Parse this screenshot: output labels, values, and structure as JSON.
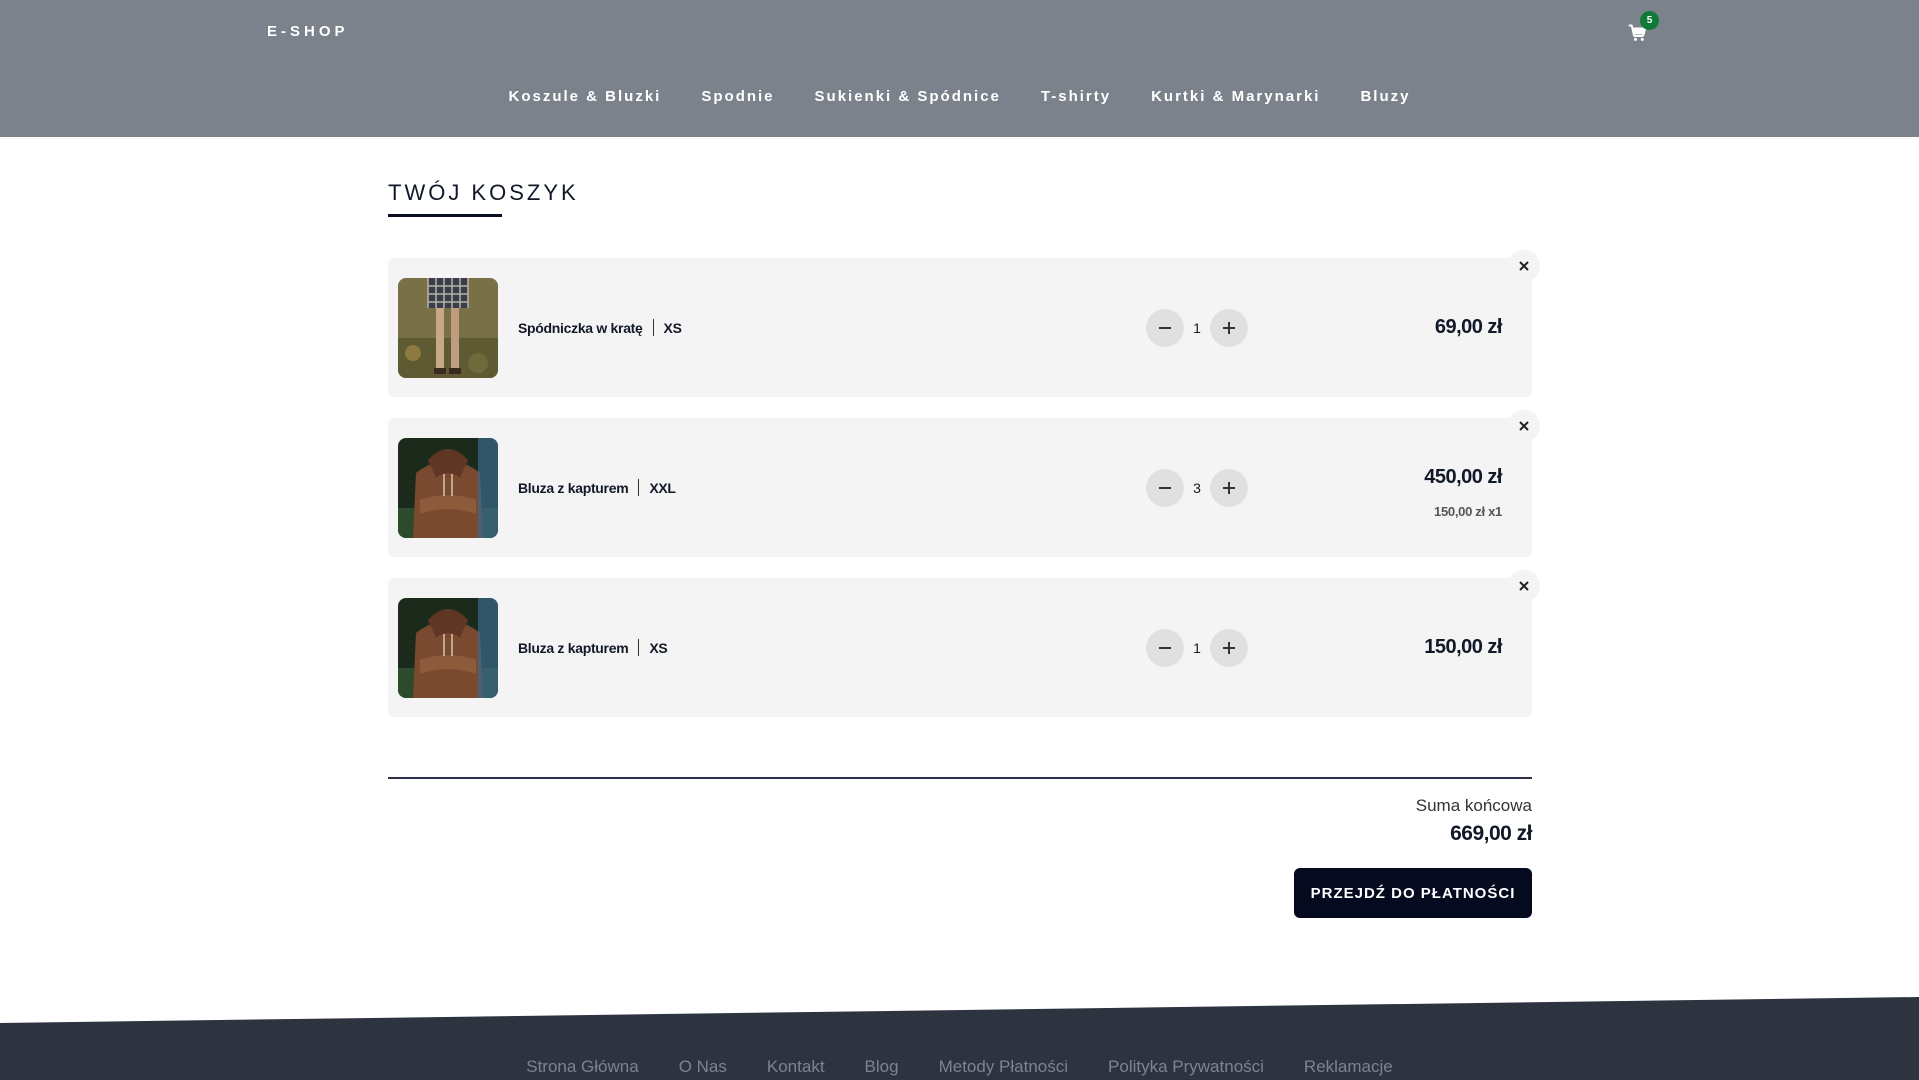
{
  "header": {
    "logo": "E-SHOP",
    "cart_count": "5",
    "nav": [
      "Koszule & Bluzki",
      "Spodnie",
      "Sukienki & Spódnice",
      "T-shirty",
      "Kurtki & Marynarki",
      "Bluzy"
    ]
  },
  "cart": {
    "title": "TWÓJ KOSZYK",
    "items": [
      {
        "name": "Spódniczka w kratę",
        "size": "XS",
        "qty": "1",
        "price": "69,00 zł",
        "unit_price": ""
      },
      {
        "name": "Bluza z kapturem",
        "size": "XXL",
        "qty": "3",
        "price": "450,00 zł",
        "unit_price": "150,00 zł x1"
      },
      {
        "name": "Bluza z kapturem",
        "size": "XS",
        "qty": "1",
        "price": "150,00 zł",
        "unit_price": ""
      }
    ],
    "total_label": "Suma końcowa",
    "total_value": "669,00 zł",
    "checkout_label": "PRZEJDŹ DO PŁATNOŚCI"
  },
  "footer": {
    "links": [
      "Strona Główna",
      "O Nas",
      "Kontakt",
      "Blog",
      "Metody Płatności",
      "Polityka Prywatności",
      "Reklamacje"
    ]
  },
  "colors": {
    "header_bg": "#7c828c",
    "badge": "#0f7a3a",
    "checkout_bg": "#050a1f",
    "footer_bg": "#2d333f"
  }
}
